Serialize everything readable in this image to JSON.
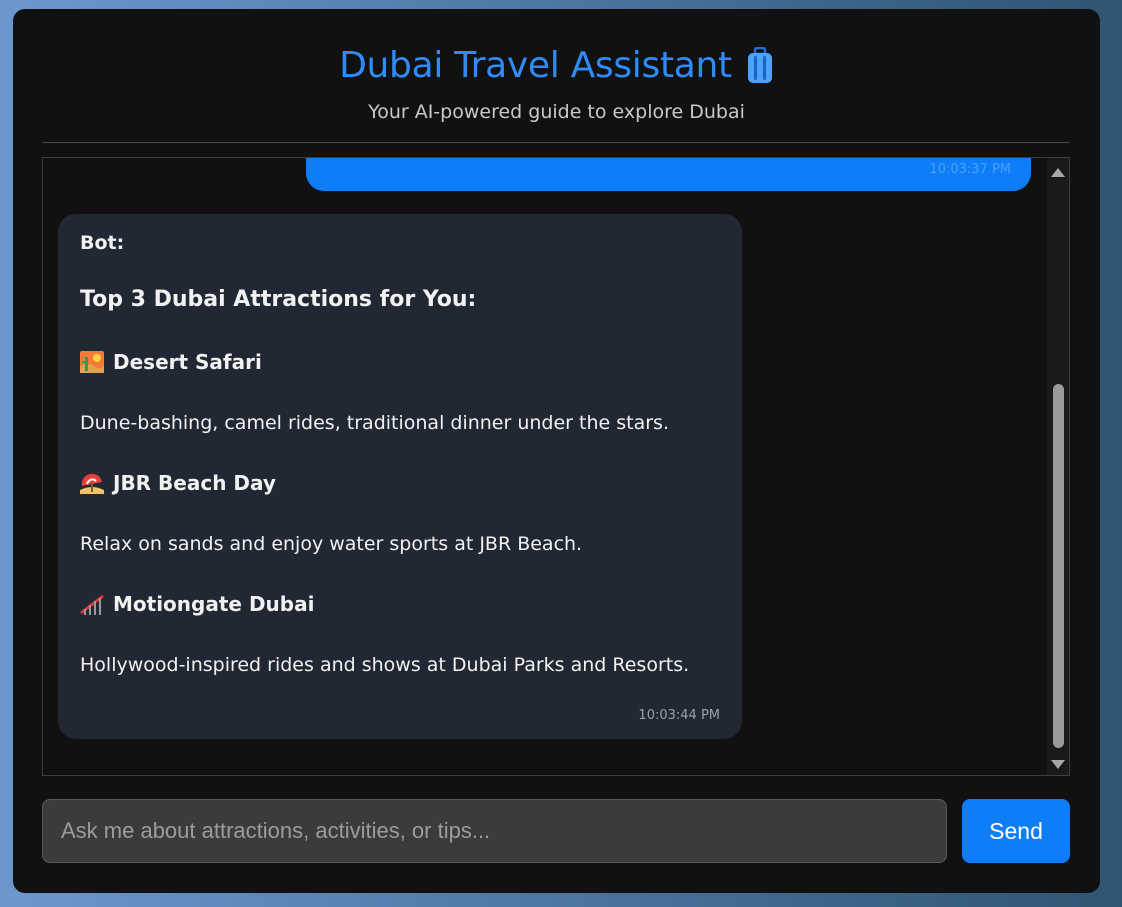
{
  "app": {
    "title": "Dubai Travel Assistant",
    "subtitle": "Your AI-powered guide to explore Dubai",
    "title_icon": "luggage-icon"
  },
  "chat": {
    "user_message": {
      "text": "",
      "time": "10:03:37 PM"
    },
    "bot_message": {
      "sender": "Bot:",
      "heading": "Top 3 Dubai Attractions for You:",
      "items": [
        {
          "icon": "desert-icon",
          "title": "Desert Safari",
          "description": "Dune-bashing, camel rides, traditional dinner under the stars."
        },
        {
          "icon": "beach-umbrella-icon",
          "title": "JBR Beach Day",
          "description": "Relax on sands and enjoy water sports at JBR Beach."
        },
        {
          "icon": "roller-coaster-icon",
          "title": "Motiongate Dubai",
          "description": "Hollywood-inspired rides and shows at Dubai Parks and Resorts."
        }
      ],
      "time": "10:03:44 PM"
    }
  },
  "input": {
    "placeholder": "Ask me about attractions, activities, or tips...",
    "value": ""
  },
  "send_button": {
    "label": "Send"
  },
  "colors": {
    "accent": "#0d7ef8",
    "title": "#2f8cf6",
    "panel": "#111111",
    "bot_bubble": "#212833"
  }
}
